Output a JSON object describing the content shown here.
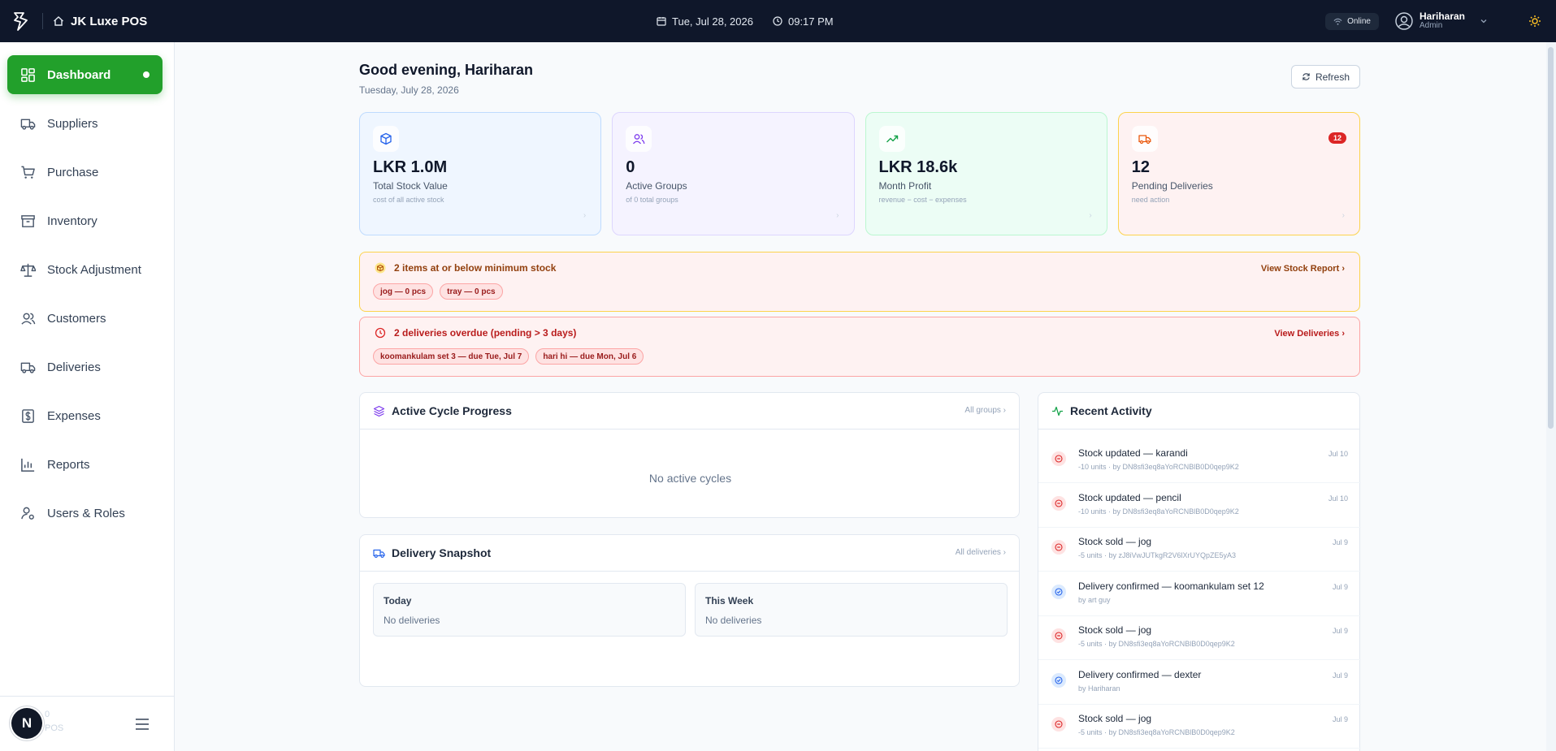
{
  "topbar": {
    "app_name": "JK Luxe POS",
    "date": "Tue, Jul 28, 2026",
    "time": "09:17 PM",
    "status": "Online",
    "user_name": "Hariharan",
    "user_role": "Admin"
  },
  "sidebar": {
    "items": [
      {
        "label": "Dashboard",
        "icon": "dashboard-icon"
      },
      {
        "label": "Suppliers",
        "icon": "truck-icon"
      },
      {
        "label": "Purchase",
        "icon": "cart-icon"
      },
      {
        "label": "Inventory",
        "icon": "archive-icon"
      },
      {
        "label": "Stock Adjustment",
        "icon": "scale-icon"
      },
      {
        "label": "Customers",
        "icon": "users-icon"
      },
      {
        "label": "Deliveries",
        "icon": "truck-icon"
      },
      {
        "label": "Expenses",
        "icon": "dollar-icon"
      },
      {
        "label": "Reports",
        "icon": "bar-chart-icon"
      },
      {
        "label": "Users & Roles",
        "icon": "user-cog-icon"
      }
    ],
    "footer_badge": "N",
    "footer_line1": "0",
    "footer_line2": "POS"
  },
  "main": {
    "greeting": "Good evening, Hariharan",
    "date": "Tuesday, July 28, 2026",
    "refresh_label": "Refresh",
    "cards": [
      {
        "value": "LKR 1.0M",
        "label": "Total Stock Value",
        "sub": "cost of all active stock"
      },
      {
        "value": "0",
        "label": "Active Groups",
        "sub": "of 0 total groups"
      },
      {
        "value": "LKR 18.6k",
        "label": "Month Profit",
        "sub": "revenue − cost − expenses"
      },
      {
        "value": "12",
        "label": "Pending Deliveries",
        "sub": "need action",
        "badge": "12"
      }
    ],
    "stock_alert": {
      "title": "2 items at or below minimum stock",
      "link": "View Stock Report",
      "chips": [
        "jog — 0 pcs",
        "tray — 0 pcs"
      ]
    },
    "delivery_alert": {
      "title": "2 deliveries overdue (pending > 3 days)",
      "link": "View Deliveries",
      "chips": [
        "koomankulam set 3 — due Tue, Jul 7",
        "hari hi — due Mon, Jul 6"
      ]
    },
    "cycle": {
      "title": "Active Cycle Progress",
      "link": "All groups",
      "empty": "No active cycles"
    },
    "snapshot": {
      "title": "Delivery Snapshot",
      "link": "All deliveries",
      "today_label": "Today",
      "today_value": "No deliveries",
      "week_label": "This Week",
      "week_value": "No deliveries"
    },
    "activity": {
      "title": "Recent Activity",
      "items": [
        {
          "text": "Stock updated — karandi",
          "meta": "-10 units · by DN8sfi3eq8aYoRCNBlB0D0qep9K2",
          "date": "Jul 10",
          "kind": "red"
        },
        {
          "text": "Stock updated — pencil",
          "meta": "-10 units · by DN8sfi3eq8aYoRCNBlB0D0qep9K2",
          "date": "Jul 10",
          "kind": "red"
        },
        {
          "text": "Stock sold — jog",
          "meta": "-5 units · by zJ8iVwJUTkgR2V6lXrUYQpZE5yA3",
          "date": "Jul 9",
          "kind": "red"
        },
        {
          "text": "Delivery confirmed — koomankulam set 12",
          "meta": "by art guy",
          "date": "Jul 9",
          "kind": "blue"
        },
        {
          "text": "Stock sold — jog",
          "meta": "-5 units · by DN8sfi3eq8aYoRCNBlB0D0qep9K2",
          "date": "Jul 9",
          "kind": "red"
        },
        {
          "text": "Delivery confirmed — dexter",
          "meta": "by Hariharan",
          "date": "Jul 9",
          "kind": "blue"
        },
        {
          "text": "Stock sold — jog",
          "meta": "-5 units · by DN8sfi3eq8aYoRCNBlB0D0qep9K2",
          "date": "Jul 9",
          "kind": "red"
        }
      ]
    }
  },
  "colors": {
    "topbar": "#0f172a",
    "accent": "#22a02b",
    "danger": "#dc2626"
  }
}
